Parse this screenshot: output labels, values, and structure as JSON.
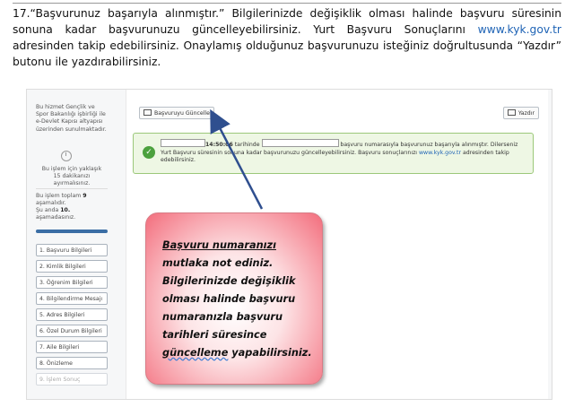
{
  "instruction": {
    "part1": "17.“Başvurunuz başarıyla alınmıştır.” Bilgilerinizde değişiklik olması halinde başvuru süresinin sonuna kadar başvurunuzu güncelleyebilirsiniz. Yurt Başvuru Sonuçlarını ",
    "link": "www.kyk.gov.tr",
    "part2": " adresinden takip edebilirsiniz. Onaylamış olduğunuz başvurunuzu isteğiniz doğrultusunda “Yazdır” butonu ile yazdırabilirsiniz."
  },
  "sidebar": {
    "info": "Bu hizmet Gençlik ve Spor Bakanlığı işbirliği ile e-Devlet Kapısı altyapısı üzerinden sunulmaktadır.",
    "wait": "Bu işlem için yaklaşık 15 dakikanızı ayırmalısınız.",
    "steps_total_prefix": "Bu işlem toplam ",
    "steps_total": "9",
    "steps_total_suffix": " aşamalıdır.",
    "current_prefix": "Şu anda ",
    "current": "10.",
    "current_suffix": " aşamadasınız.",
    "progress": 1.0,
    "steps": [
      "1. Başvuru Bilgileri",
      "2. Kimlik Bilgileri",
      "3. Öğrenim Bilgileri",
      "4. Bilgilendirme Mesajı",
      "5. Adres Bilgileri",
      "6. Özel Durum Bilgileri",
      "7. Aile Bilgileri",
      "8. Önizleme",
      "9. İşlem Sonuç"
    ]
  },
  "main": {
    "update_button": "Başvuruyu Güncelle",
    "print_button": "Yazdır",
    "alert": {
      "time": "14:50:06",
      "text1": " tarihinde ",
      "text2": " başvuru numarasıyla başvurunuz başarıyla alınmıştır. Dilerseniz Yurt Başvuru süresinin sonuna kadar başvurunuzu güncelleyebilirsiniz. Başvuru sonuçlarınızı ",
      "link": "www.kyk.gov.tr",
      "text3": " adresinden takip edebilirsiniz."
    }
  },
  "callout": {
    "line1": "Başvuru numaranızı",
    "line2": "mutlaka not ediniz.",
    "line3": "Bilgilerinizde değişiklik",
    "line4": "olması halinde başvuru",
    "line5": "numaranızla başvuru",
    "line6": "tarihleri süresince",
    "line7_a": "güncelleme",
    "line7_b": " yapabilirsiniz."
  },
  "colors": {
    "link": "#1e63b5",
    "alert_bg": "#eef7e4",
    "check": "#4ca13e",
    "callout_edge": "#f36d7c"
  }
}
